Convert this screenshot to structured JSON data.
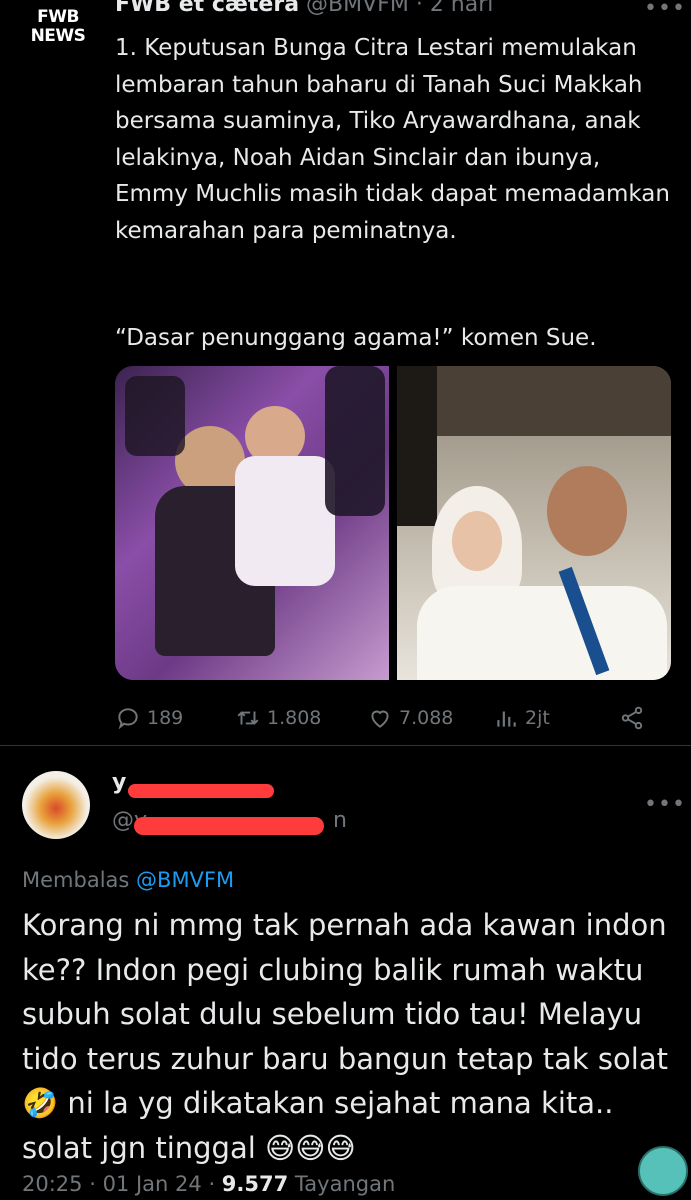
{
  "tweet": {
    "avatar_text": [
      "FWB",
      "NEWS"
    ],
    "name": "FWB et cætera",
    "handle": "@BMVFM",
    "separator": "·",
    "time": "2 hari",
    "more_label": "•••",
    "text_paragraph": "1. Keputusan Bunga Citra Lestari memulakan lembaran tahun baharu di Tanah Suci Makkah bersama suaminya, Tiko Aryawardhana, anak lelakinya, Noah Aidan Sinclair dan ibunya, Emmy Muchlis masih tidak dapat memadamkan kemarahan para peminatnya.",
    "text_quote": "“Dasar penunggang agama!” komen Sue.",
    "actions": {
      "replies": "189",
      "retweets": "1.808",
      "likes": "7.088",
      "views": "2jt"
    }
  },
  "reply": {
    "name": "y",
    "handle_suffix": "n",
    "handle_prefix": "@y",
    "more_label": "•••",
    "replying_to_label": "Membalas",
    "replying_to_handle": "@BMVFM",
    "text": "Korang ni mmg tak pernah ada kawan indon ke?? Indon pegi clubing balik rumah waktu subuh solat dulu sebelum tido tau! Melayu tido terus zuhur baru bangun tetap tak solat 🤣 ni la yg dikatakan sejahat mana kita.. solat jgn tinggal 😅😅😅",
    "time": "20:25",
    "date": "01 Jan 24",
    "view_count": "9.577",
    "view_label": "Tayangan"
  },
  "colors": {
    "background": "#000000",
    "text_primary": "#e7e9ea",
    "text_secondary": "#71767b",
    "accent": "#1d9bf0",
    "redaction": "#ff3b3b"
  },
  "icons": [
    "reply-icon",
    "retweet-icon",
    "like-icon",
    "views-icon",
    "share-icon",
    "more-icon"
  ]
}
